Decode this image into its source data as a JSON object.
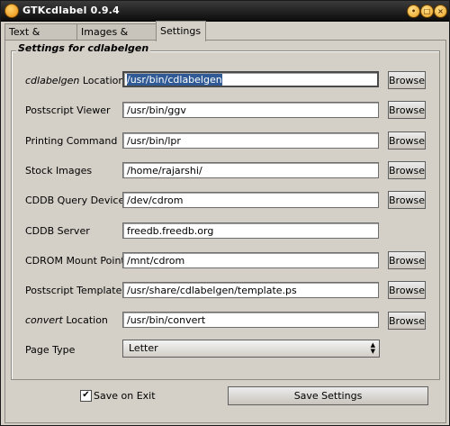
{
  "window": {
    "title": "GTKcdlabel 0.9.4",
    "buttons": {
      "minimize": "•",
      "maximize": "□",
      "close": "×"
    }
  },
  "tabs": [
    {
      "label": "Text & Printing"
    },
    {
      "label": "Images & Colors"
    },
    {
      "label": "Settings",
      "active": true
    }
  ],
  "frame_title": "Settings for cdlabelgen",
  "settings": [
    {
      "label_italic": "cdlabelgen",
      "label_rest": " Location",
      "value": "/usr/bin/cdlabelgen",
      "browse": "Browse"
    },
    {
      "label": "Postscript Viewer",
      "value": "/usr/bin/ggv",
      "browse": "Browse"
    },
    {
      "label": "Printing Command",
      "value": "/usr/bin/lpr",
      "browse": "Browse"
    },
    {
      "label": "Stock Images",
      "value": "/home/rajarshi/",
      "browse": "Browse"
    },
    {
      "label": "CDDB Query Device",
      "value": "/dev/cdrom",
      "browse": "Browse"
    },
    {
      "label": "CDDB Server",
      "value": "freedb.freedb.org"
    },
    {
      "label": "CDROM Mount Point",
      "value": "/mnt/cdrom",
      "browse": "Browse"
    },
    {
      "label": "Postscript Template",
      "value": "/usr/share/cdlabelgen/template.ps",
      "browse": "Browse"
    },
    {
      "label_italic": "convert",
      "label_rest": " Location",
      "value": "/usr/bin/convert",
      "browse": "Browse"
    }
  ],
  "page_type": {
    "label": "Page Type",
    "selected": "Letter"
  },
  "save_on_exit": {
    "label": "Save on Exit",
    "checked": true,
    "mark": "✔"
  },
  "save_button": "Save Settings"
}
